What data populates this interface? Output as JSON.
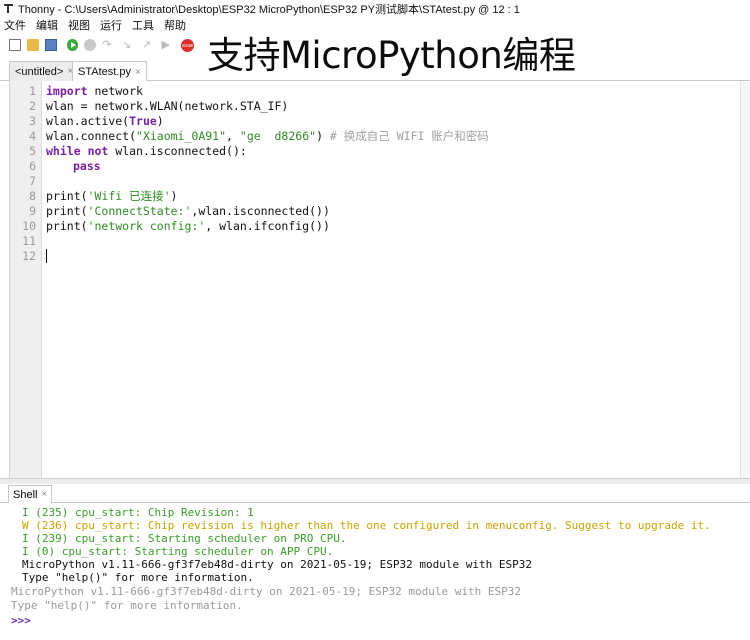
{
  "window": {
    "title": "Thonny  -  C:\\Users\\Administrator\\Desktop\\ESP32 MicroPython\\ESP32 PY测试脚本\\STAtest.py  @  12 : 1"
  },
  "menu": [
    "文件",
    "编辑",
    "视图",
    "运行",
    "工具",
    "帮助"
  ],
  "toolbar": {
    "icons": [
      "new-file-icon",
      "open-file-icon",
      "save-icon",
      "run-icon",
      "debug-icon",
      "step-over-icon",
      "step-into-icon",
      "step-out-icon",
      "resume-icon",
      "stop-icon"
    ],
    "stop_label": "STOP"
  },
  "banner": "支持MicroPython编程",
  "tabs": [
    {
      "label": "<untitled>",
      "close": "×"
    },
    {
      "label": "STAtest.py",
      "close": "×"
    }
  ],
  "editor": {
    "line_numbers": [
      "1",
      "2",
      "3",
      "4",
      "5",
      "6",
      "7",
      "8",
      "9",
      "10",
      "11",
      "12"
    ],
    "lines": {
      "l1_kw": "import",
      "l1_rest": " network",
      "l2": "wlan = network.WLAN(network.STA_IF)",
      "l3_pre": "wlan.active(",
      "l3_kw": "True",
      "l3_post": ")",
      "l4_pre": "wlan.connect(",
      "l4_s1": "\"Xiaomi_0A91\"",
      "l4_mid": ", ",
      "l4_s2": "\"ge  d8266\"",
      "l4_post": ") ",
      "l4_comment": "# 换成自己 WIFI 账户和密码",
      "l5_kw1": "while",
      "l5_sp": " ",
      "l5_kw2": "not",
      "l5_rest": " wlan.isconnected():",
      "l6_kw": "pass",
      "l8_pre": "print(",
      "l8_str": "'Wifi 已连接'",
      "l8_post": ")",
      "l9_pre": "print(",
      "l9_str": "'ConnectState:'",
      "l9_post": ",wlan.isconnected())",
      "l10_pre": "print(",
      "l10_str": "'network config:'",
      "l10_post": ", wlan.ifconfig())"
    }
  },
  "shell": {
    "tab_label": "Shell",
    "tab_close": "×",
    "lines": [
      "I (235) cpu_start: Chip Revision: 1",
      "W (236) cpu_start: Chip revision is higher than the one configured in menuconfig. Suggest to upgrade it.",
      "I (239) cpu_start: Starting scheduler on PRO CPU.",
      "I (0) cpu_start: Starting scheduler on APP CPU.",
      "MicroPython v1.11-666-gf3f7eb48d-dirty on 2021-05-19; ESP32 module with ESP32",
      "Type \"help()\" for more information.",
      "MicroPython v1.11-666-gf3f7eb48d-dirty on 2021-05-19; ESP32 module with ESP32",
      "Type \"help()\" for more information."
    ],
    "prompt": ">>>"
  },
  "colors": {
    "keyword": "#7b1fa2",
    "string": "#2e8b22",
    "comment": "#a0a0a0",
    "shell_info": "#3b9e2a",
    "shell_warning": "#c9a200",
    "shell_prompt": "#6c2bb0"
  }
}
